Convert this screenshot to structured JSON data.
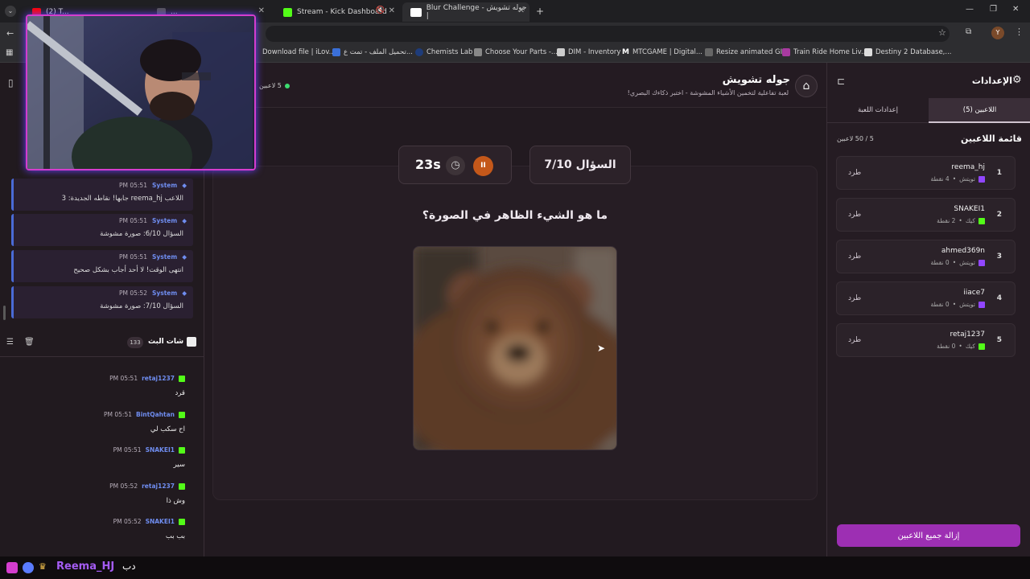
{
  "browser": {
    "tabs": [
      {
        "title": "(2) T..."
      },
      {
        "title": "..."
      },
      {
        "title": "Stream - Kick Dashboard"
      },
      {
        "title": "Blur Challenge - جوله تشويش |"
      }
    ],
    "bookmarks": [
      "Download file | iLov...",
      "تحميل الملف - تمت ع...",
      "Chemists Lab",
      "Choose Your Parts -...",
      "DIM - Inventory",
      "MTCGAME | Digital...",
      "Resize animated GIF",
      "Train Ride Home Liv...",
      "Destiny 2 Database,..."
    ],
    "profile_initial": "Y"
  },
  "header": {
    "title": "جوله تشويش",
    "subtitle": "لعبة تفاعلية لتخمين الأشياء المشوشة - اختبر ذكاءك البصري!",
    "players_online": "5 لاعبين"
  },
  "system_messages": [
    {
      "sender": "System",
      "time": "PM 05:51",
      "text": "اللاعب reema_hj جابها! نقاطه الجديدة: 3"
    },
    {
      "sender": "System",
      "time": "PM 05:51",
      "text": "السؤال 6/10: صورة مشوشة"
    },
    {
      "sender": "System",
      "time": "PM 05:51",
      "text": "انتهى الوقت! لا أحد أجاب بشكل صحيح"
    },
    {
      "sender": "System",
      "time": "PM 05:52",
      "text": "السؤال 7/10: صورة مشوشة"
    }
  ],
  "chat": {
    "title": "شات البث",
    "count": "133",
    "messages": [
      {
        "user": "retaj1237",
        "time": "PM 05:51",
        "text": "قرد"
      },
      {
        "user": "BintQahtan",
        "time": "PM 05:51",
        "text": "اح سكب لي"
      },
      {
        "user": "SNAKEI1",
        "time": "PM 05:51",
        "text": "سير"
      },
      {
        "user": "retaj1237",
        "time": "PM 05:52",
        "text": "وش ذا"
      },
      {
        "user": "SNAKEI1",
        "time": "PM 05:52",
        "text": "بب بب"
      }
    ]
  },
  "game": {
    "question_label": "السؤال 7/10",
    "timer": "23s",
    "prompt": "ما هو الشيء الظاهر في الصورة؟"
  },
  "settings": {
    "title": "الإعدادات",
    "tabs": [
      {
        "label": "اللاعبين (5)",
        "active": true
      },
      {
        "label": "إعدادات اللعبة",
        "active": false
      }
    ],
    "players_heading": "قائمة اللاعبين",
    "players_count": "5 / 50 لاعبين",
    "kick_label": "طرد",
    "players": [
      {
        "rank": "1",
        "name": "reema_hj",
        "platform": "تويتش",
        "points": "4 نقطة",
        "platform_color": "#9146ff"
      },
      {
        "rank": "2",
        "name": "SNAKEI1",
        "platform": "كيك",
        "points": "2 نقطة",
        "platform_color": "#53fc18"
      },
      {
        "rank": "3",
        "name": "ahmed369n",
        "platform": "تويتش",
        "points": "0 نقطة",
        "platform_color": "#9146ff"
      },
      {
        "rank": "4",
        "name": "iiace7",
        "platform": "تويتش",
        "points": "0 نقطة",
        "platform_color": "#9146ff"
      },
      {
        "rank": "5",
        "name": "retaj1237",
        "platform": "كيك",
        "points": "0 نقطة",
        "platform_color": "#53fc18"
      }
    ],
    "remove_all_label": "إزالة جميع اللاعبين"
  },
  "overlay": {
    "streamer_name": "Reema_HJ",
    "suffix": "دب"
  },
  "colors": {
    "accent": "#9d2fb3",
    "pause_button": "#c4581a",
    "kick_green": "#53fc18",
    "twitch_purple": "#9146ff"
  }
}
